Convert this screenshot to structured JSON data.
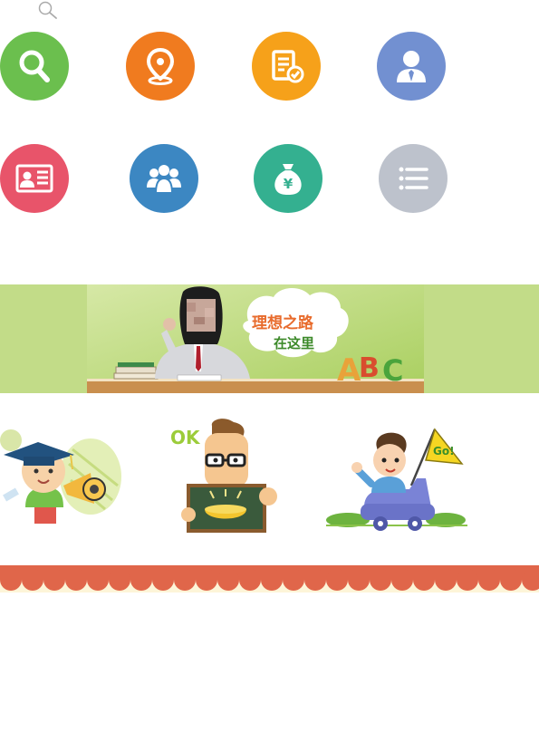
{
  "header": {
    "icon": "search-icon"
  },
  "grid": {
    "tiles": [
      {
        "name": "search",
        "icon": "magnifier-icon",
        "color": "#6bbf4e"
      },
      {
        "name": "location",
        "icon": "map-pin-icon",
        "color": "#f07b1f"
      },
      {
        "name": "document",
        "icon": "document-check-icon",
        "color": "#f6a11a"
      },
      {
        "name": "person",
        "icon": "person-icon",
        "color": "#7290d1"
      },
      {
        "name": "id-card",
        "icon": "id-card-icon",
        "color": "#e8546a"
      },
      {
        "name": "group",
        "icon": "group-icon",
        "color": "#3c87c2"
      },
      {
        "name": "money",
        "icon": "money-bag-icon",
        "color": "#34b090"
      },
      {
        "name": "list",
        "icon": "list-icon",
        "color": "#bdc2cc"
      }
    ]
  },
  "banner": {
    "line1": "理想之路",
    "line2": "在这里",
    "letters": [
      "A",
      "B",
      "C"
    ],
    "background": "#c2dc88"
  },
  "cards": {
    "ok_text": "OK",
    "flag_text": "Go!"
  },
  "footer": {
    "scallop_color": "#e0664a"
  }
}
